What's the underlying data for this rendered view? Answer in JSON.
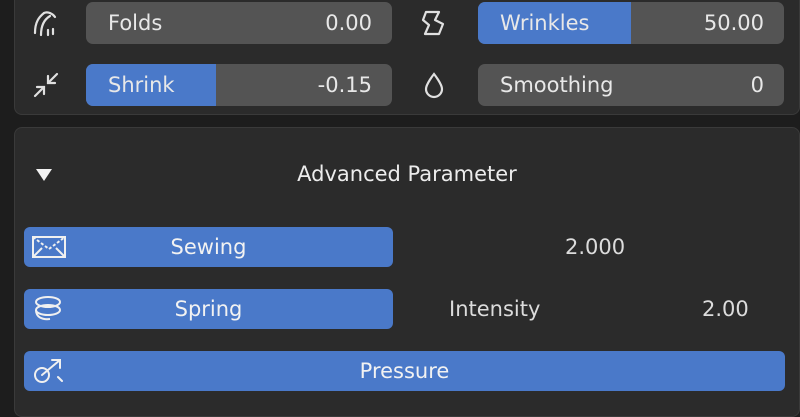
{
  "top": {
    "folds": {
      "label": "Folds",
      "value": "0.00",
      "fill": 0,
      "icon": "folds-icon"
    },
    "wrinkles": {
      "label": "Wrinkles",
      "value": "50.00",
      "fill": 0.5,
      "icon": "wrinkles-icon"
    },
    "shrink": {
      "label": "Shrink",
      "value": "-0.15",
      "fill": 0.425,
      "icon": "shrink-icon"
    },
    "smoothing": {
      "label": "Smoothing",
      "value": "0",
      "fill": 0,
      "icon": "droplet-icon"
    }
  },
  "advanced": {
    "title": "Advanced Parameter",
    "toggle_icon": "triangle-down-icon",
    "sewing": {
      "label": "Sewing",
      "value": "2.000",
      "icon": "sewing-icon"
    },
    "spring": {
      "label": "Spring",
      "intensity_label": "Intensity",
      "intensity_value": "2.00",
      "icon": "spring-icon"
    },
    "pressure": {
      "label": "Pressure",
      "icon": "pressure-icon"
    }
  },
  "colors": {
    "accent": "#4a79c9",
    "field": "#545454",
    "panel": "#2b2b2b",
    "background": "#1d1d1d"
  }
}
